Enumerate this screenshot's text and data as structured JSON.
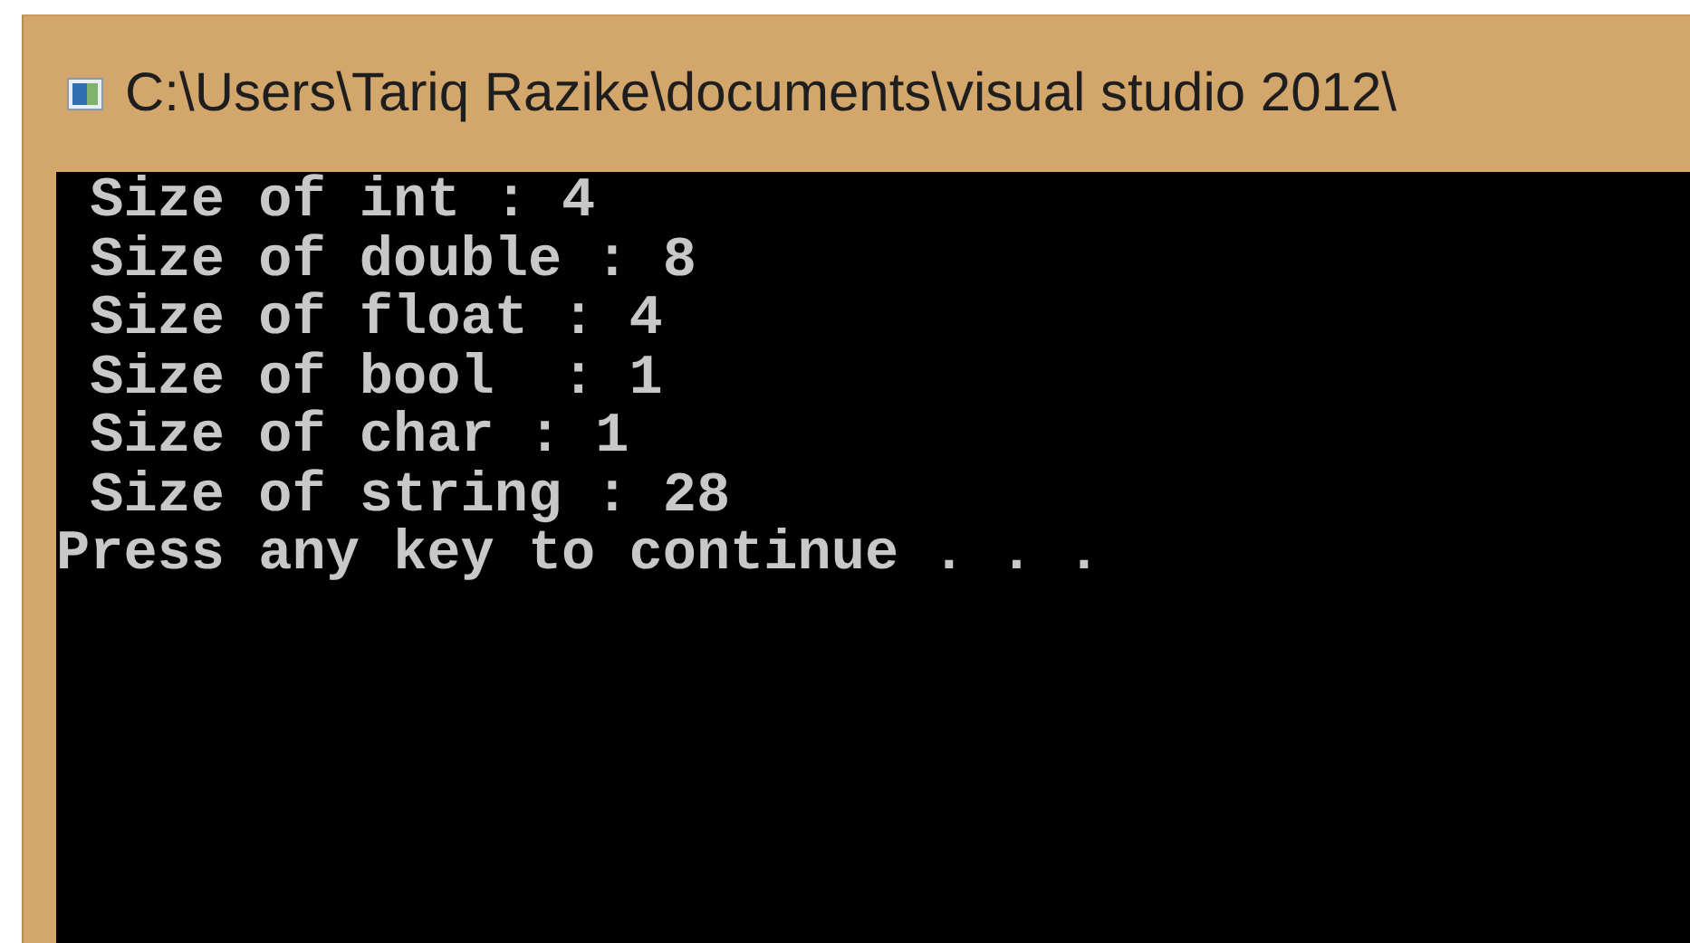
{
  "window": {
    "title": "C:\\Users\\Tariq Razike\\documents\\visual studio 2012\\"
  },
  "console": {
    "lines": [
      " Size of int : 4",
      " Size of double : 8",
      " Size of float : 4",
      " Size of bool  : 1",
      " Size of char : 1",
      " Size of string : 28",
      "Press any key to continue . . ."
    ]
  }
}
